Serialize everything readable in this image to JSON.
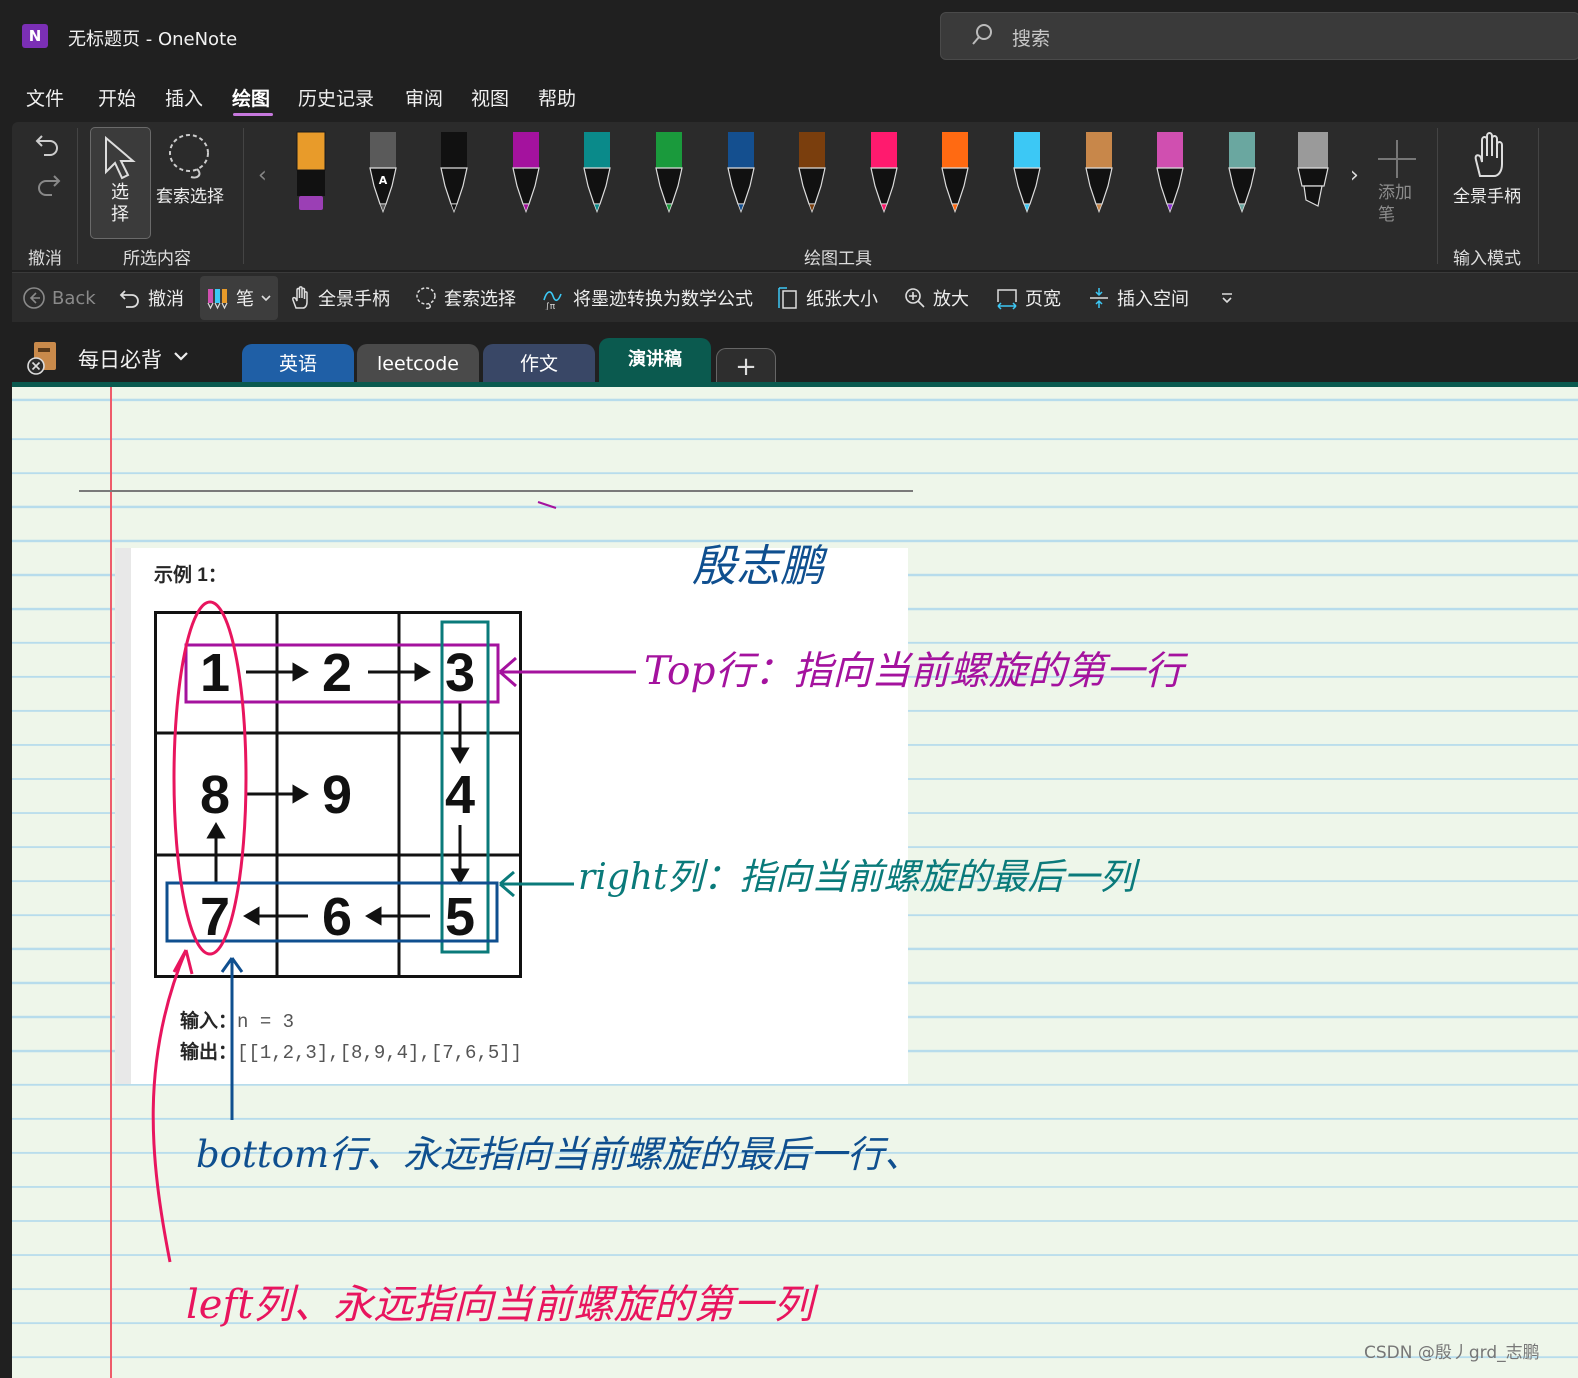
{
  "titlebar": {
    "app_logo": "N",
    "title": "无标题页  -  OneNote",
    "search_placeholder": "搜索"
  },
  "menu": {
    "items": [
      "文件",
      "开始",
      "插入",
      "绘图",
      "历史记录",
      "审阅",
      "视图",
      "帮助"
    ],
    "active": "绘图"
  },
  "ribbon": {
    "groups": {
      "undo": "撤消",
      "selection": "所选内容",
      "drawing_tools": "绘图工具",
      "input_mode": "输入模式"
    },
    "select_label": "选择",
    "lasso_label": "套索选择",
    "add_pen_label": "添加笔",
    "panhand_label": "全景手柄",
    "pens": [
      {
        "name": "orange-highlighter",
        "color": "#e89b2a",
        "tip": "#9b3fb5"
      },
      {
        "name": "pencil",
        "color": "#5a5a5a",
        "tip": "#5a5a5a",
        "badge": "A"
      },
      {
        "name": "black-pen",
        "color": "#111111",
        "tip": "#111111"
      },
      {
        "name": "purple-pen",
        "color": "#a4129e",
        "tip": "#a4129e"
      },
      {
        "name": "teal-pen",
        "color": "#0a8a8a",
        "tip": "#0a8a8a"
      },
      {
        "name": "green-pen",
        "color": "#1a9a3c",
        "tip": "#1a9a3c"
      },
      {
        "name": "navy-pen",
        "color": "#144f8f",
        "tip": "#144f8f"
      },
      {
        "name": "brown-pen",
        "color": "#7a3e0d",
        "tip": "#7a3e0d"
      },
      {
        "name": "pink-pen",
        "color": "#ff1a6e",
        "tip": "#ff1a6e"
      },
      {
        "name": "orange-pen",
        "color": "#ff6a12",
        "tip": "#ff6a12"
      },
      {
        "name": "sky-pen",
        "color": "#3cc8f5",
        "tip": "#3cc8f5"
      },
      {
        "name": "wood-texture-pen",
        "color": "#c8874a",
        "tip": "#c8874a"
      },
      {
        "name": "rainbow-pen",
        "color": "#d04fb0",
        "tip": "#8b2fd0"
      },
      {
        "name": "galaxy-pen",
        "color": "#6aa7a0",
        "tip": "#6aa7a0"
      },
      {
        "name": "gray-marker",
        "color": "#9a9a9a",
        "tip": "#9a9a9a"
      }
    ]
  },
  "qat": {
    "back": "Back",
    "undo": "撤消",
    "pen": "笔",
    "panhand": "全景手柄",
    "lasso": "套索选择",
    "ink_to_math": "将墨迹转换为数学公式",
    "paper_size": "纸张大小",
    "zoom_in": "放大",
    "page_width": "页宽",
    "insert_space": "插入空间"
  },
  "notebook": {
    "name": "每日必背",
    "tabs": [
      {
        "label": "英语",
        "color": "#1f5fa6",
        "active": false
      },
      {
        "label": "leetcode",
        "color": "#4a4a4a",
        "active": false
      },
      {
        "label": "作文",
        "color": "#394766",
        "active": false
      },
      {
        "label": "演讲稿",
        "color": "#0b5a4f",
        "active": true
      }
    ],
    "add_tab": "+"
  },
  "example": {
    "title": "示例 1：",
    "grid": [
      "1",
      "2",
      "3",
      "8",
      "9",
      "4",
      "7",
      "6",
      "5"
    ],
    "input_label": "输入：",
    "input_value": "n = 3",
    "output_label": "输出：",
    "output_value": "[[1,2,3],[8,9,4],[7,6,5]]"
  },
  "ink_notes": {
    "signature": "殷志鹏",
    "top": "Top行：指向当前螺旋的第一行",
    "right": "right列：指向当前螺旋的最后一列",
    "bottom": "bottom行、永远指向当前螺旋的最后一行、",
    "left": "left列、永远指向当前螺旋的第一列",
    "colors": {
      "top": "#a4129e",
      "right": "#0a7a7a",
      "bottom": "#0f4f8f",
      "left": "#e8155e"
    }
  },
  "watermark": "CSDN @殷丿grd_志鹏"
}
